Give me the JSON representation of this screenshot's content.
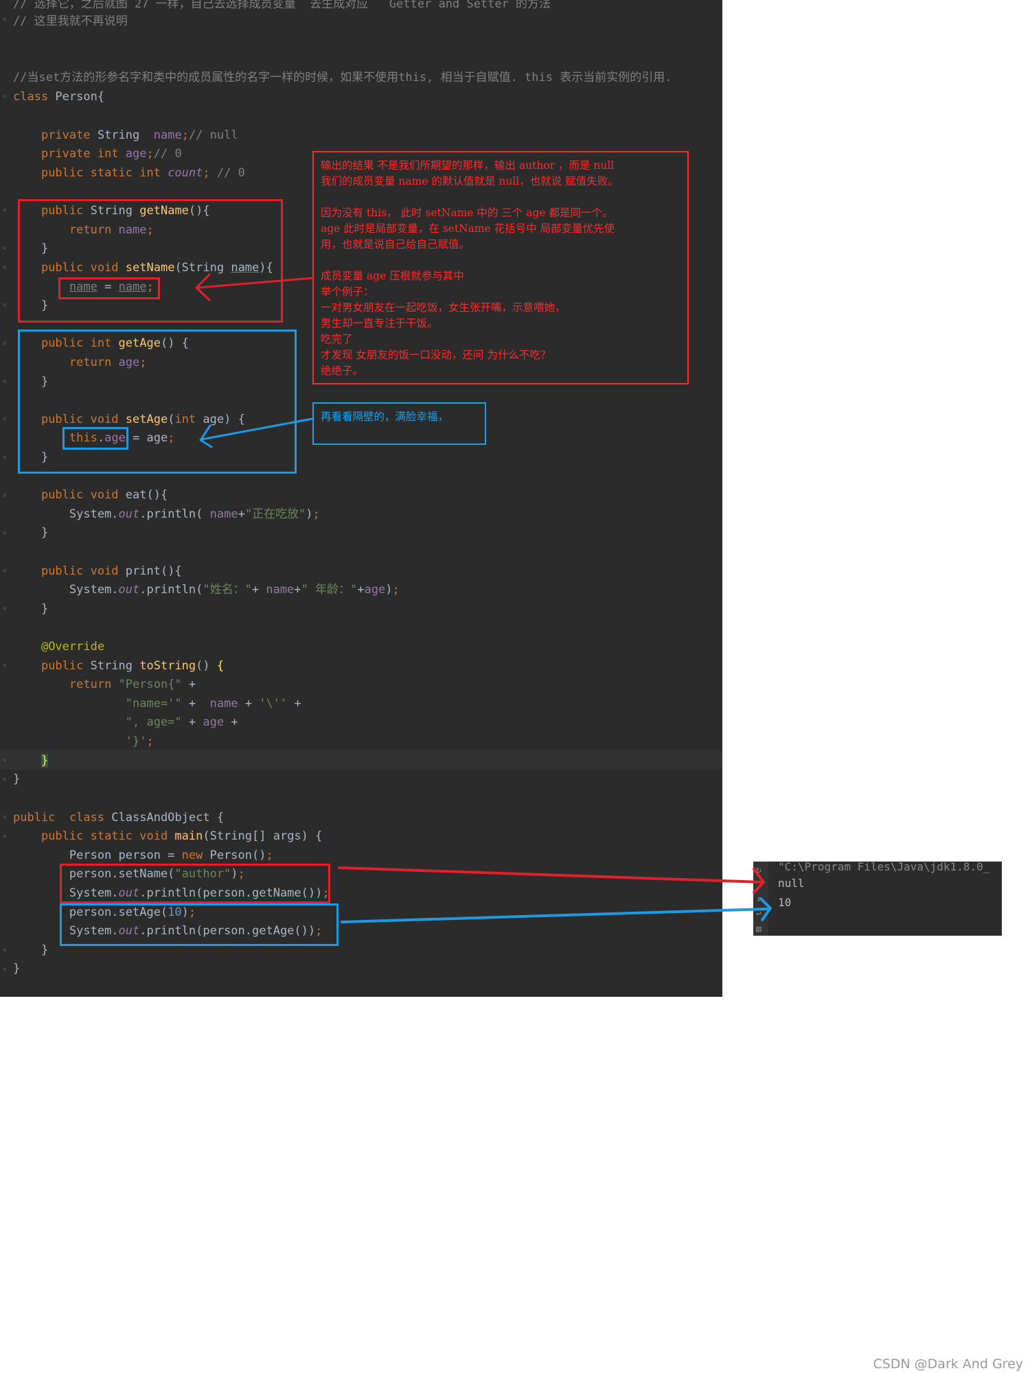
{
  "code": {
    "comment_top_1": "// 选择它，之后就图 27 一样，自己去选择成员变量  去生成对应   Getter and Setter 的方法",
    "comment_top_2": "// 这里我就不再说明",
    "comment_this": "//当set方法的形参名字和类中的成员属性的名字一样的时候，如果不使用this, 相当于自赋值. this 表示当前实例的引用.",
    "class_person": "Person",
    "field_name_comment": "// null",
    "field_age_comment": "// 0",
    "field_count_comment": "// 0",
    "eat_string": "\"正在吃放\"",
    "print_string_1": "\"姓名：\"",
    "print_string_2": "\" 年龄：\"",
    "annotation": "@Override",
    "tostring_1": "\"Person{\"",
    "tostring_2": "\"name='\"",
    "tostring_3": "'\\''",
    "tostring_4": "\", age=\"",
    "tostring_5": "'}'",
    "class_main": "ClassAndObject",
    "set_name_arg": "\"author\"",
    "set_age_arg": "10"
  },
  "notes": {
    "red": "输出的结果 不是我们所期望的那样，输出 author ，而是 null\n我们的成员变量 name 的默认值就是 null，也就说 赋值失败。\n\n因为没有 this， 此时 setName 中的 三个 age 都是同一个。\nage 此时是局部变量，在 setName 花括号中 局部变量优先使\n用，也就是说自己给自己赋值。\n\n成员变量 age 压根就参与其中\n举个例子：\n一对男女朋友在一起吃饭，女生张开嘴，示意喂她，\n男生却一直专注于干饭。\n吃完了\n才发现 女朋友的饭一口没动，还问 为什么不吃？\n绝绝子。",
    "blue": "再看看隔壁的，满脸幸福，"
  },
  "console": {
    "path": "\"C:\\Program Files\\Java\\jdk1.8.0_",
    "line1": "null",
    "line2": "10"
  },
  "colors": {
    "red_annotation": "#e0202a",
    "blue_annotation": "#1e9be0",
    "editor_bg": "#2b2b2b"
  },
  "watermark": "CSDN @Dark And Grey"
}
